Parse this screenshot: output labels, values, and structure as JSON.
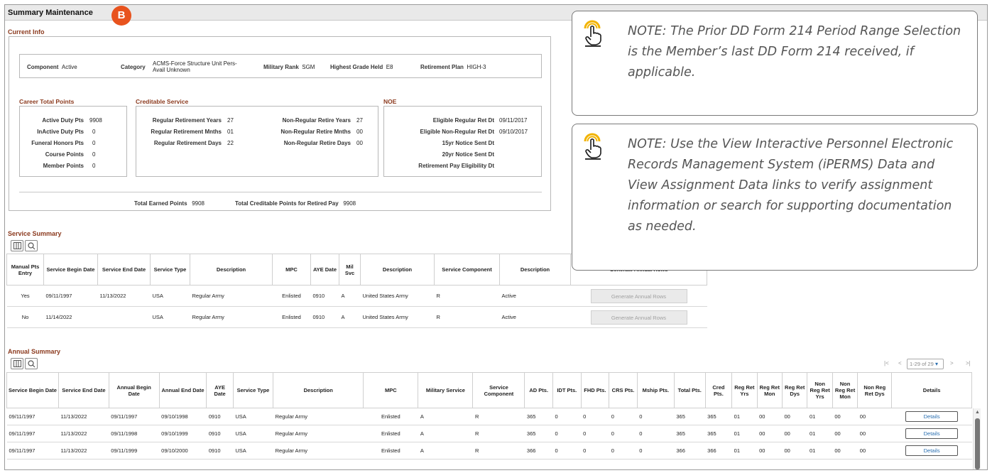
{
  "page": {
    "title": "Summary Maintenance",
    "marker": "B"
  },
  "current_info": {
    "label": "Current Info",
    "component": {
      "label": "Component",
      "value": "Active"
    },
    "category": {
      "label": "Category",
      "value_line1": "ACMS-Force Structure Unit Pers-",
      "value_line2": "Avail Unknown"
    },
    "military_rank": {
      "label": "Military Rank",
      "value": "SGM"
    },
    "highest_grade": {
      "label": "Highest Grade Held",
      "value": "E8"
    },
    "retirement_plan": {
      "label": "Retirement Plan",
      "value": "HIGH-3"
    },
    "career_total_points": {
      "title": "Career Total Points",
      "rows": [
        {
          "label": "Active Duty Pts",
          "value": "9908"
        },
        {
          "label": "InActive Duty Pts",
          "value": "0"
        },
        {
          "label": "Funeral Honors Pts",
          "value": "0"
        },
        {
          "label": "Course Points",
          "value": "0"
        },
        {
          "label": "Member Points",
          "value": "0"
        }
      ]
    },
    "creditable_service": {
      "title": "Creditable Service",
      "left": [
        {
          "label": "Regular Retirement Years",
          "value": "27"
        },
        {
          "label": "Regular Retirement Mnths",
          "value": "01"
        },
        {
          "label": "Regular Retirement Days",
          "value": "22"
        }
      ],
      "right": [
        {
          "label": "Non-Regular Retire Years",
          "value": "27"
        },
        {
          "label": "Non-Regular Retire Mnths",
          "value": "00"
        },
        {
          "label": "Non-Regular Retire Days",
          "value": "00"
        }
      ]
    },
    "noe": {
      "title": "NOE",
      "rows": [
        {
          "label": "Eligible Regular Ret Dt",
          "value": "09/11/2017"
        },
        {
          "label": "Eligible Non-Regular Ret Dt",
          "value": "09/10/2017"
        },
        {
          "label": "15yr Notice Sent Dt",
          "value": ""
        },
        {
          "label": "20yr Notice Sent Dt",
          "value": ""
        },
        {
          "label": "Retirement Pay Eligibility Dt",
          "value": ""
        }
      ]
    },
    "total_earned": {
      "label": "Total Earned Points",
      "value": "9908"
    },
    "total_creditable": {
      "label": "Total Creditable Points for Retired Pay",
      "value": "9908"
    }
  },
  "service_summary": {
    "label": "Service Summary",
    "headers": [
      "Manual Pts Entry",
      "Service Begin Date",
      "Service End Date",
      "Service Type",
      "Description",
      "MPC",
      "AYE Date",
      "Mil Svc",
      "Description",
      "Service Component",
      "Description",
      "Generate Annual Rows"
    ],
    "rows": [
      {
        "manual": "Yes",
        "begin": "09/11/1997",
        "end": "11/13/2022",
        "type": "USA",
        "desc1": "Regular Army",
        "mpc": "Enlisted",
        "aye": "0910",
        "milsvc": "A",
        "desc2": "United States Army",
        "component": "R",
        "desc3": "Active",
        "button": "Generate Annual Rows"
      },
      {
        "manual": "No",
        "begin": "11/14/2022",
        "end": "",
        "type": "USA",
        "desc1": "Regular Army",
        "mpc": "Enlisted",
        "aye": "0910",
        "milsvc": "A",
        "desc2": "United States Army",
        "component": "R",
        "desc3": "Active",
        "button": "Generate Annual Rows"
      }
    ]
  },
  "annual_summary": {
    "label": "Annual Summary",
    "pager": {
      "range": "1-29 of 29"
    },
    "headers": [
      "Service Begin Date",
      "Service End Date",
      "Annual Begin Date",
      "Annual End Date",
      "AYE Date",
      "Service Type",
      "Description",
      "MPC",
      "Military Service",
      "Service Component",
      "AD Pts.",
      "IDT Pts.",
      "FHD Pts.",
      "CRS Pts.",
      "Mship Pts.",
      "Total Pts.",
      "Cred Pts.",
      "Reg Ret Yrs",
      "Reg Ret Mon",
      "Reg Ret Dys",
      "Non Reg Ret Yrs",
      "Non Reg Ret Mon",
      "Non Reg Ret Dys",
      "Details"
    ],
    "rows": [
      [
        "09/11/1997",
        "11/13/2022",
        "09/11/1997",
        "09/10/1998",
        "0910",
        "USA",
        "Regular Army",
        "Enlisted",
        "A",
        "R",
        "365",
        "0",
        "0",
        "0",
        "0",
        "365",
        "365",
        "01",
        "00",
        "00",
        "01",
        "00",
        "00",
        "Details"
      ],
      [
        "09/11/1997",
        "11/13/2022",
        "09/11/1998",
        "09/10/1999",
        "0910",
        "USA",
        "Regular Army",
        "Enlisted",
        "A",
        "R",
        "365",
        "0",
        "0",
        "0",
        "0",
        "365",
        "365",
        "01",
        "00",
        "00",
        "01",
        "00",
        "00",
        "Details"
      ],
      [
        "09/11/1997",
        "11/13/2022",
        "09/11/1999",
        "09/10/2000",
        "0910",
        "USA",
        "Regular Army",
        "Enlisted",
        "A",
        "R",
        "366",
        "0",
        "0",
        "0",
        "0",
        "366",
        "366",
        "01",
        "00",
        "00",
        "01",
        "00",
        "00",
        "Details"
      ]
    ]
  },
  "notes": [
    {
      "text": "NOTE: The Prior DD Form 214 Period Range Selection is the Member’s last DD Form 214 received, if applicable.",
      "icon": "tap-icon"
    },
    {
      "text": "NOTE: Use the View Interactive Personnel Electronic Records Management System (iPERMS) Data and View Assignment Data links to verify assignment information or search for supporting documentation as needed.",
      "icon": "tap-icon"
    }
  ],
  "colors": {
    "section_label": "#8b3a1e",
    "marker": "#e8531e",
    "note_text": "#555555",
    "icon_ring": "#f2b300"
  }
}
